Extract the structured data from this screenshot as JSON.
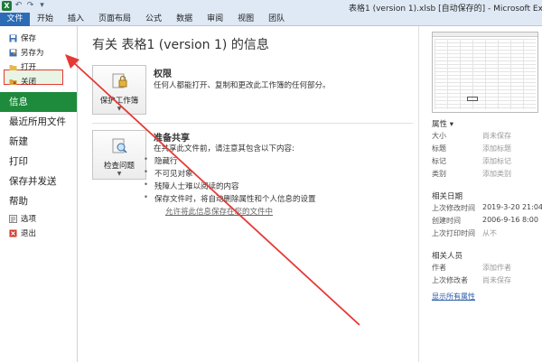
{
  "window": {
    "title": "表格1 (version 1).xlsb [自动保存的] - Microsoft Excel",
    "xl_letter": "X"
  },
  "quick_access": [
    "↶",
    "↷",
    "▾"
  ],
  "tabs": [
    {
      "label": "文件",
      "id": "file"
    },
    {
      "label": "开始",
      "id": "home"
    },
    {
      "label": "插入",
      "id": "insert"
    },
    {
      "label": "页面布局",
      "id": "page-layout"
    },
    {
      "label": "公式",
      "id": "formulas"
    },
    {
      "label": "数据",
      "id": "data"
    },
    {
      "label": "审阅",
      "id": "review"
    },
    {
      "label": "视图",
      "id": "view"
    },
    {
      "label": "团队",
      "id": "team"
    }
  ],
  "nav": {
    "save": "保存",
    "save_as": "另存为",
    "open": "打开",
    "close": "关闭",
    "info": "信息",
    "recent": "最近所用文件",
    "new": "新建",
    "print": "打印",
    "save_send": "保存并发送",
    "help": "帮助",
    "options": "选项",
    "exit": "退出"
  },
  "main": {
    "title": "有关 表格1 (version 1) 的信息",
    "permissions": {
      "button": "保护工作簿",
      "heading": "权限",
      "text": "任何人都能打开、复制和更改此工作簿的任何部分。"
    },
    "prepare": {
      "button": "检查问题",
      "heading": "准备共享",
      "text": "在共享此文件前，请注意其包含以下内容:",
      "bullets": [
        "隐藏行",
        "不可见对象",
        "残障人士难以阅读的内容",
        "保存文件时，将自动删除属性和个人信息的设置"
      ],
      "link": "允许将此信息保存在您的文件中"
    }
  },
  "properties": {
    "header": "属性 ▾",
    "rows": [
      {
        "k": "大小",
        "v": "尚未保存"
      },
      {
        "k": "标题",
        "v": "添加标题"
      },
      {
        "k": "标记",
        "v": "添加标记"
      },
      {
        "k": "类别",
        "v": "添加类别"
      }
    ],
    "dates_header": "相关日期",
    "dates": [
      {
        "k": "上次修改时间",
        "v": "2019-3-20 21:04"
      },
      {
        "k": "创建时间",
        "v": "2006-9-16 8:00"
      },
      {
        "k": "上次打印时间",
        "v": "从不"
      }
    ],
    "people_header": "相关人员",
    "people": [
      {
        "k": "作者",
        "v": "添加作者"
      },
      {
        "k": "上次修改者",
        "v": "尚未保存"
      }
    ],
    "show_all": "显示所有属性"
  },
  "colors": {
    "accent_green": "#1d8a3c",
    "file_tab_blue": "#2c6bb5",
    "annotation_red": "#e53935"
  }
}
